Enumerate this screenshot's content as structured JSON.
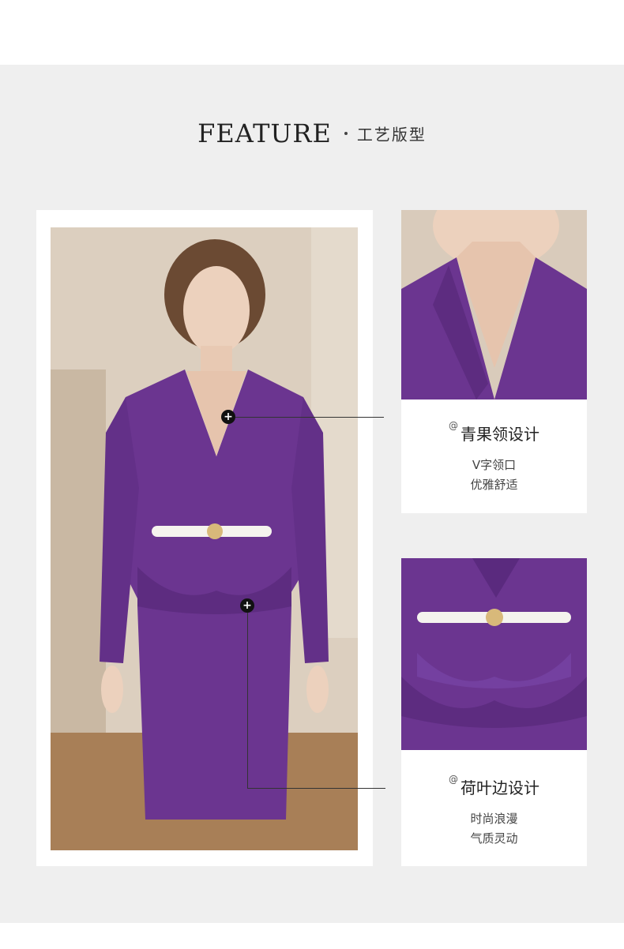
{
  "heading": {
    "en": "FEATURE",
    "cn": "工艺版型"
  },
  "feature1": {
    "title": "青果领设计",
    "lines": [
      "V字领口",
      "优雅舒适"
    ]
  },
  "feature2": {
    "title": "荷叶边设计",
    "lines": [
      "时尚浪漫",
      "气质灵动"
    ]
  },
  "marker": {
    "at": "@",
    "plus": "+"
  },
  "colors": {
    "background": "#efefef",
    "suit": "#6b3590",
    "belt": "#f5f3ee"
  }
}
